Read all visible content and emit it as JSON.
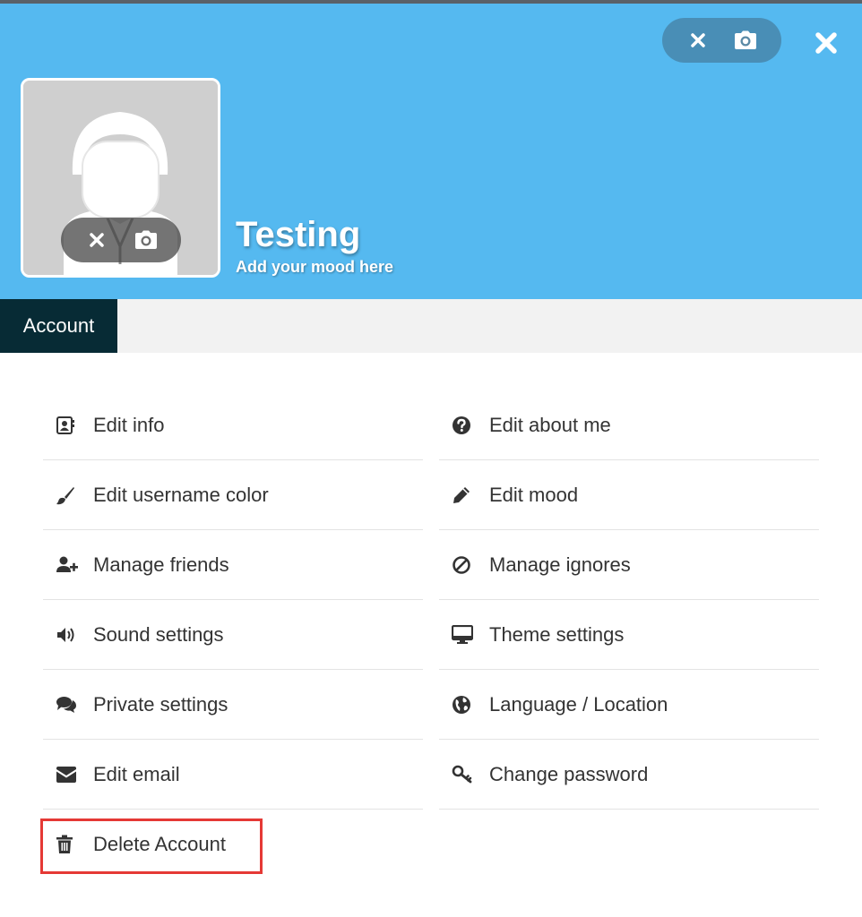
{
  "colors": {
    "header_bg": "#55b9f0",
    "tab_active_bg": "#072b35",
    "pill_bg": "rgba(60,90,110,0.45)",
    "highlight": "#e53935"
  },
  "header": {
    "username": "Testing",
    "mood": "Add your mood here",
    "cover_actions": {
      "remove_icon": "x-icon",
      "upload_icon": "camera-icon"
    },
    "close_icon": "close-icon",
    "avatar_actions": {
      "remove_icon": "x-icon",
      "upload_icon": "camera-icon"
    }
  },
  "tabs": [
    {
      "label": "Account",
      "active": true
    }
  ],
  "menu": {
    "left": [
      {
        "label": "Edit info",
        "icon": "address-card-icon"
      },
      {
        "label": "Edit username color",
        "icon": "paint-brush-icon"
      },
      {
        "label": "Manage friends",
        "icon": "user-plus-icon"
      },
      {
        "label": "Sound settings",
        "icon": "volume-icon"
      },
      {
        "label": "Private settings",
        "icon": "comments-icon"
      },
      {
        "label": "Edit email",
        "icon": "envelope-icon"
      },
      {
        "label": "Delete Account",
        "icon": "trash-icon"
      }
    ],
    "right": [
      {
        "label": "Edit about me",
        "icon": "question-circle-icon"
      },
      {
        "label": "Edit mood",
        "icon": "pencil-icon"
      },
      {
        "label": "Manage ignores",
        "icon": "ban-icon"
      },
      {
        "label": "Theme settings",
        "icon": "desktop-icon"
      },
      {
        "label": "Language / Location",
        "icon": "globe-icon"
      },
      {
        "label": "Change password",
        "icon": "key-icon"
      }
    ]
  }
}
